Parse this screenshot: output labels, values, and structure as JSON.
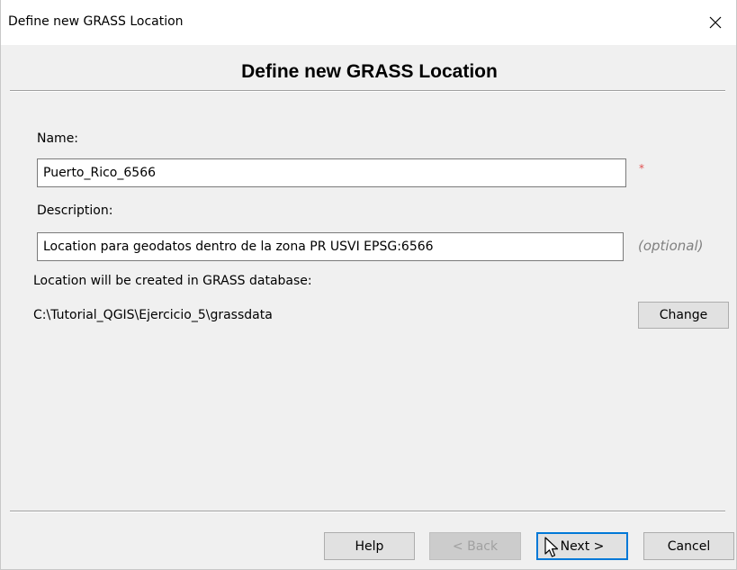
{
  "window": {
    "title": "Define new GRASS Location",
    "close_icon": "close-icon"
  },
  "heading": "Define new GRASS Location",
  "form": {
    "name_label": "Name:",
    "name_value": "Puerto_Rico_6566",
    "name_required_mark": "*",
    "description_label": "Description:",
    "description_value": "Location para geodatos dentro de la zona PR USVI EPSG:6566",
    "description_optional_hint": "(optional)",
    "database_label": "Location will be created in GRASS database:",
    "database_path": "C:\\Tutorial_QGIS\\Ejercicio_5\\grassdata",
    "change_button": "Change"
  },
  "buttons": {
    "help": "Help",
    "back": "< Back",
    "next": "Next >",
    "cancel": "Cancel"
  },
  "colors": {
    "required": "#e05050",
    "optional_hint": "#808080",
    "focus": "#0078d7"
  }
}
